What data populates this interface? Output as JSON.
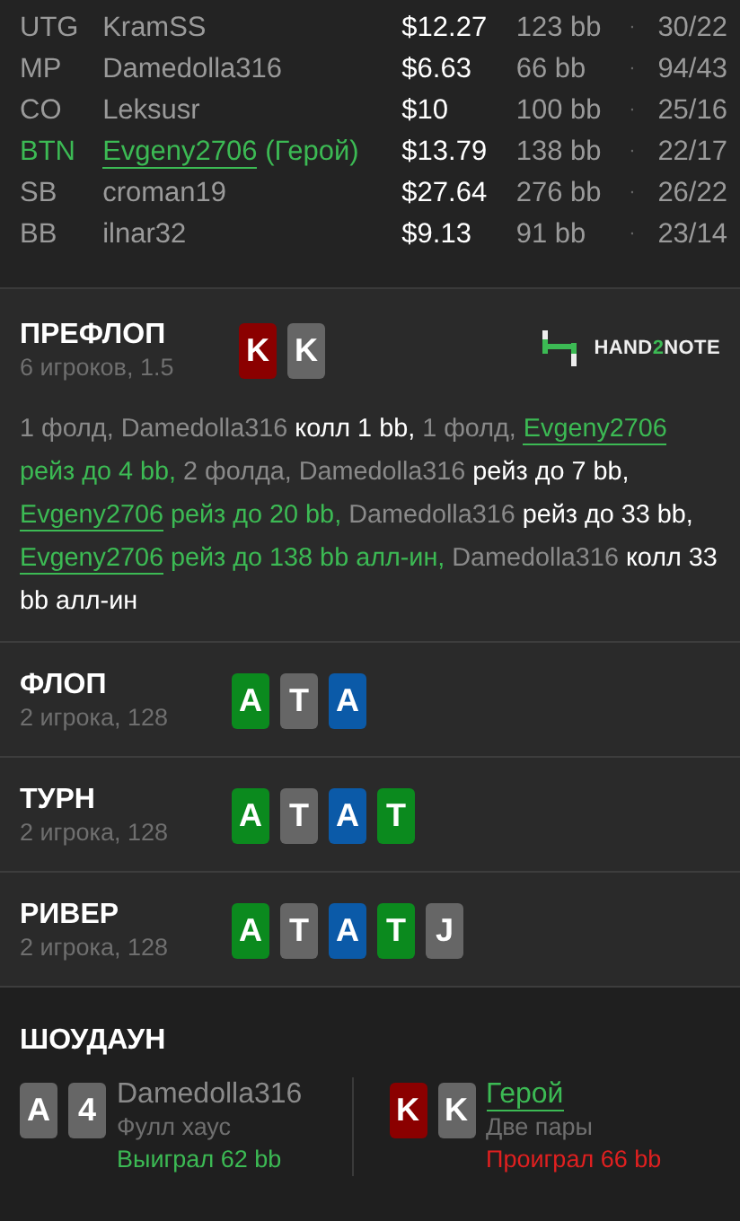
{
  "players": [
    {
      "position": "UTG",
      "name": "KramSS",
      "hero": false,
      "stack": "$12.27",
      "bb": "123 bb",
      "stats": "30/22"
    },
    {
      "position": "MP",
      "name": "Damedolla316",
      "hero": false,
      "stack": "$6.63",
      "bb": "66 bb",
      "stats": "94/43"
    },
    {
      "position": "CO",
      "name": "Leksusr",
      "hero": false,
      "stack": "$10",
      "bb": "100 bb",
      "stats": "25/16"
    },
    {
      "position": "BTN",
      "name": "Evgeny2706",
      "hero": true,
      "hero_label": "(Герой)",
      "stack": "$13.79",
      "bb": "138 bb",
      "stats": "22/17"
    },
    {
      "position": "SB",
      "name": "croman19",
      "hero": false,
      "stack": "$27.64",
      "bb": "276 bb",
      "stats": "26/22"
    },
    {
      "position": "BB",
      "name": "ilnar32",
      "hero": false,
      "stack": "$9.13",
      "bb": "91 bb",
      "stats": "23/14"
    }
  ],
  "stat_separator": "·",
  "preflop": {
    "title": "ПРЕФЛОП",
    "subtitle": "6 игроков, 1.5",
    "cards": [
      {
        "rank": "K",
        "color": "#8b0000"
      },
      {
        "rank": "K",
        "color": "#666666"
      }
    ],
    "logo": [
      {
        "text": "HAND",
        "accent": false
      },
      {
        "text": "2",
        "accent": true
      },
      {
        "text": "NOTE",
        "accent": false
      }
    ],
    "actions": [
      {
        "kind": "muted",
        "text": "1 фолд, Damedolla316 "
      },
      {
        "kind": "action",
        "text": "колл 1 bb, "
      },
      {
        "kind": "muted",
        "text": "1 фолд, "
      },
      {
        "kind": "hero",
        "text": "Evgeny2706"
      },
      {
        "kind": "hero_action",
        "text": " рейз до 4 bb, "
      },
      {
        "kind": "muted",
        "text": "2 фолда, Damedolla316 "
      },
      {
        "kind": "action",
        "text": "рейз до 7 bb, "
      },
      {
        "kind": "hero",
        "text": "Evgeny2706"
      },
      {
        "kind": "hero_action",
        "text": " рейз до 20 bb, "
      },
      {
        "kind": "muted",
        "text": "Damedolla316 "
      },
      {
        "kind": "action",
        "text": "рейз до 33 bb, "
      },
      {
        "kind": "hero",
        "text": "Evgeny2706"
      },
      {
        "kind": "hero_action",
        "text": " рейз до 138 bb алл-ин, "
      },
      {
        "kind": "muted",
        "text": "Damedolla316 "
      },
      {
        "kind": "action",
        "text": "колл 33 bb алл-ин"
      }
    ]
  },
  "streets": [
    {
      "title": "ФЛОП",
      "subtitle": "2 игрока, 128",
      "cards": [
        {
          "rank": "A",
          "color": "#0b8a1e"
        },
        {
          "rank": "T",
          "color": "#666666"
        },
        {
          "rank": "A",
          "color": "#0b5aa8"
        }
      ]
    },
    {
      "title": "ТУРН",
      "subtitle": "2 игрока, 128",
      "cards": [
        {
          "rank": "A",
          "color": "#0b8a1e"
        },
        {
          "rank": "T",
          "color": "#666666"
        },
        {
          "rank": "A",
          "color": "#0b5aa8"
        },
        {
          "rank": "T",
          "color": "#0b8a1e"
        }
      ]
    },
    {
      "title": "РИВЕР",
      "subtitle": "2 игрока, 128",
      "cards": [
        {
          "rank": "A",
          "color": "#0b8a1e"
        },
        {
          "rank": "T",
          "color": "#666666"
        },
        {
          "rank": "A",
          "color": "#0b5aa8"
        },
        {
          "rank": "T",
          "color": "#0b8a1e"
        },
        {
          "rank": "J",
          "color": "#666666"
        }
      ]
    }
  ],
  "showdown": {
    "title": "ШОУДАУН",
    "hands": [
      {
        "cards": [
          {
            "rank": "A",
            "color": "#666666"
          },
          {
            "rank": "4",
            "color": "#666666"
          }
        ],
        "name": "Damedolla316",
        "hero": false,
        "combo": "Фулл хаус",
        "result": "Выиграл 62 bb",
        "won": true
      },
      {
        "cards": [
          {
            "rank": "K",
            "color": "#8b0000"
          },
          {
            "rank": "K",
            "color": "#666666"
          }
        ],
        "name": "Герой",
        "hero": true,
        "combo": "Две пары",
        "result": "Проиграл 66 bb",
        "won": false
      }
    ]
  }
}
